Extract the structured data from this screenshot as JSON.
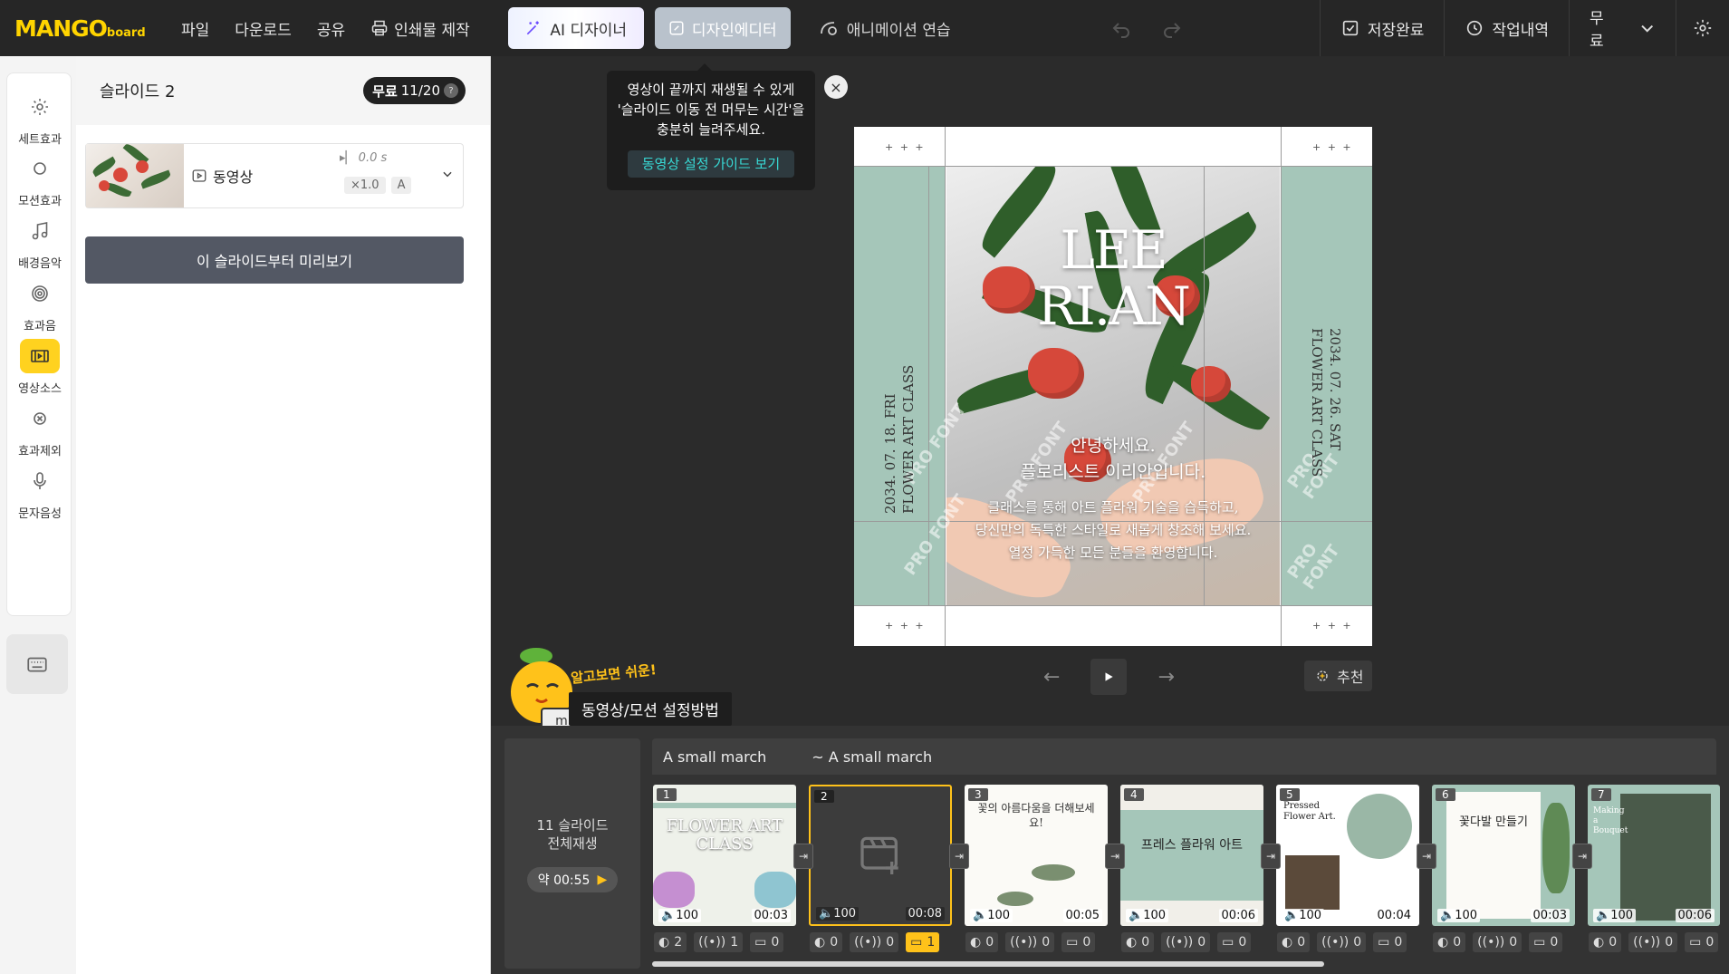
{
  "app": {
    "logo_main": "MANGO",
    "logo_sub": "board"
  },
  "topbar": {
    "menu": [
      "파일",
      "다운로드",
      "공유"
    ],
    "print_label": "인쇄물 제작",
    "ai_label": "AI 디자이너",
    "design_label": "디자인에디터",
    "anim_label": "애니메이션 연습",
    "save_label": "저장완료",
    "history_label": "작업내역",
    "plan_label": "무료"
  },
  "sidebar": {
    "items": [
      {
        "label": "세트효과",
        "icon": "gear-icon"
      },
      {
        "label": "모션효과",
        "icon": "circle-icon"
      },
      {
        "label": "배경음악",
        "icon": "music-icon"
      },
      {
        "label": "효과음",
        "icon": "sound-icon"
      },
      {
        "label": "영상소스",
        "icon": "film-icon"
      },
      {
        "label": "효과제외",
        "icon": "remove-icon"
      },
      {
        "label": "문자음성",
        "icon": "mic-icon"
      }
    ]
  },
  "panel": {
    "title": "슬라이드 2",
    "badge_free": "무료",
    "badge_count": "11/20",
    "badge_help": "?",
    "video_label": "동영상",
    "video_delay": "0.0 s",
    "video_speed": "×1.0",
    "video_mode": "A",
    "preview_button": "이 슬라이드부터 미리보기"
  },
  "tooltip": {
    "line1": "영상이 끝까지 재생될 수 있게",
    "line2": "'슬라이드 이동 전 머무는 시간'을",
    "line3": "충분히 늘려주세요.",
    "guide_link": "동영상 설정 가이드 보기",
    "close": "×"
  },
  "canvas": {
    "name_line1": "LEE",
    "name_line2": "RI.AN",
    "greet_line1": "안녕하세요.",
    "greet_line2": "플로리스트 이리안입니다.",
    "body_line1": "클래스를 통해 아트 플라워 기술을 습득하고,",
    "body_line2": "당신만의 독특한 스타일로 새롭게 창조해 보세요.",
    "body_line3": "열정 가득한 모든 분들을 환영합니다.",
    "left_date": "2034. 07. 18. FRI",
    "left_class": "FLOWER ART CLASS",
    "right_date": "2034. 07. 26. SAT",
    "right_class": "FLOWER ART CLASS",
    "watermark": "PRO FONT",
    "stars": "+ + +"
  },
  "controls": {
    "recommend_label": "추천"
  },
  "mascot": {
    "subtitle": "알고보면 쉬운!",
    "label": "동영상/모션 설정방법"
  },
  "timeline": {
    "all_line1": "11 슬라이드",
    "all_line2": "전체재생",
    "total_time": "약 00:55",
    "bgm_1": "A small march",
    "bgm_2": "~ A small march",
    "slides": [
      {
        "num": "1",
        "vol": "100",
        "dur": "00:03",
        "c1": "2",
        "c2": "1",
        "c3": "0",
        "title": "FLOWER ART CLASS"
      },
      {
        "num": "2",
        "vol": "100",
        "dur": "00:08",
        "c1": "0",
        "c2": "0",
        "c3": "1",
        "title": ""
      },
      {
        "num": "3",
        "vol": "100",
        "dur": "00:05",
        "c1": "0",
        "c2": "0",
        "c3": "0",
        "title": "꽃의 아름다움을 더해보세요!"
      },
      {
        "num": "4",
        "vol": "100",
        "dur": "00:06",
        "c1": "0",
        "c2": "0",
        "c3": "0",
        "title": "프레스 플라워 아트"
      },
      {
        "num": "5",
        "vol": "100",
        "dur": "00:04",
        "c1": "0",
        "c2": "0",
        "c3": "0",
        "title": "Pressed Flower Art."
      },
      {
        "num": "6",
        "vol": "100",
        "dur": "00:03",
        "c1": "0",
        "c2": "0",
        "c3": "0",
        "title": "꽃다발 만들기"
      },
      {
        "num": "7",
        "vol": "100",
        "dur": "00:06",
        "c1": "0",
        "c2": "0",
        "c3": "0",
        "title": "Making a Bouquet"
      }
    ]
  }
}
